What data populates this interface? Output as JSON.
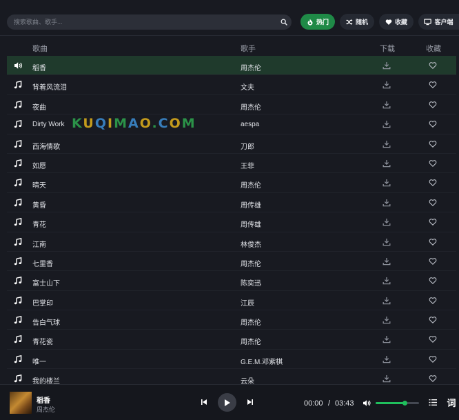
{
  "search": {
    "placeholder": "搜索歌曲、歌手..."
  },
  "nav": {
    "hot": {
      "label": "热门",
      "icon": "fire-icon"
    },
    "random": {
      "label": "随机",
      "icon": "shuffle-icon"
    },
    "favorites": {
      "label": "收藏",
      "icon": "heart-icon"
    },
    "client": {
      "label": "客户端",
      "icon": "monitor-icon"
    }
  },
  "table": {
    "headers": {
      "song": "歌曲",
      "artist": "歌手",
      "download": "下载",
      "favorite": "收藏"
    },
    "rows": [
      {
        "song": "稻香",
        "artist": "周杰伦",
        "playing": true
      },
      {
        "song": "背着风流泪",
        "artist": "文夫",
        "playing": false
      },
      {
        "song": "夜曲",
        "artist": "周杰伦",
        "playing": false
      },
      {
        "song": "Dirty Work",
        "artist": "aespa",
        "playing": false
      },
      {
        "song": "西海情歌",
        "artist": "刀郎",
        "playing": false
      },
      {
        "song": "如愿",
        "artist": "王菲",
        "playing": false
      },
      {
        "song": "晴天",
        "artist": "周杰伦",
        "playing": false
      },
      {
        "song": "黄昏",
        "artist": "周传雄",
        "playing": false
      },
      {
        "song": "青花",
        "artist": "周传雄",
        "playing": false
      },
      {
        "song": "江南",
        "artist": "林俊杰",
        "playing": false
      },
      {
        "song": "七里香",
        "artist": "周杰伦",
        "playing": false
      },
      {
        "song": "富士山下",
        "artist": "陈奕迅",
        "playing": false
      },
      {
        "song": "巴掌印",
        "artist": "江辰",
        "playing": false
      },
      {
        "song": "告白气球",
        "artist": "周杰伦",
        "playing": false
      },
      {
        "song": "青花瓷",
        "artist": "周杰伦",
        "playing": false
      },
      {
        "song": "唯一",
        "artist": "G.E.M.邓紫棋",
        "playing": false
      },
      {
        "song": "我的楼兰",
        "artist": "云朵",
        "playing": false
      }
    ]
  },
  "watermark": {
    "text": "KUQIMAO.COM"
  },
  "player": {
    "title": "稻香",
    "artist": "周杰伦",
    "current_time": "00:00",
    "separator": "/",
    "duration": "03:43",
    "volume": 0.68,
    "lyrics_label": "词"
  },
  "colors": {
    "accent": "#1f8a47",
    "active_row": "#1f3a2c",
    "background": "#181a21",
    "volume": "#1fbf5c"
  }
}
